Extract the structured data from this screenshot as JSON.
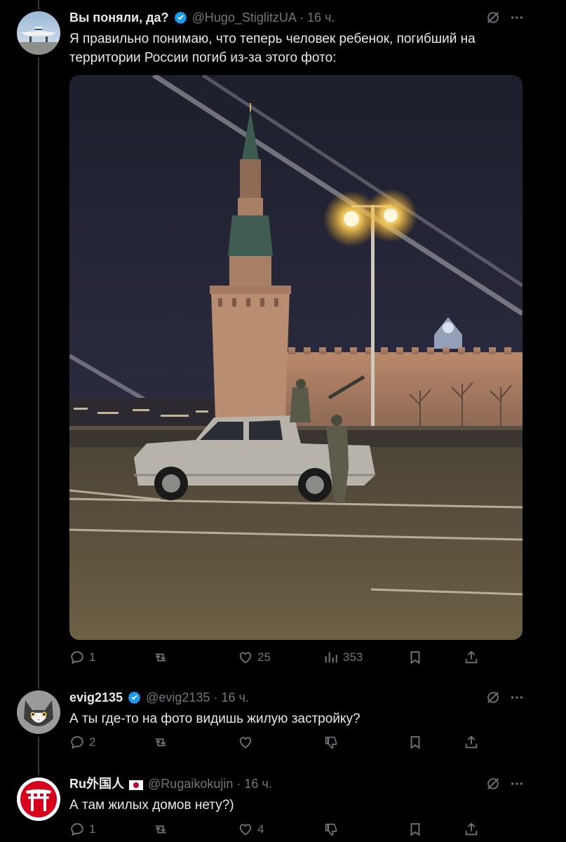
{
  "tweets": [
    {
      "name": "Вы поняли, да?",
      "handle": "@Hugo_StiglitzUA",
      "time": "· 16 ч.",
      "text": "Я правильно понимаю, что теперь человек ребенок, погибший на территории России погиб из-за этого фото:",
      "replies": "1",
      "likes": "25",
      "views": "353",
      "image_icon": "moscow-kremlin-night-photo"
    },
    {
      "name": "evig2135",
      "handle": "@evig2135",
      "time": "· 16 ч.",
      "text": "А ты где-то на фото видишь жилую застройку?",
      "replies": "2"
    },
    {
      "name": "Ru外国人",
      "handle": "@Rugaikokujin",
      "time": "· 16 ч.",
      "text": "А там жилых домов нету?)",
      "replies": "1",
      "likes": "4"
    }
  ],
  "colors": {
    "verified": "#1d9bf0",
    "muted": "#71767b",
    "background": "#000000",
    "text": "#e7e9ea"
  }
}
